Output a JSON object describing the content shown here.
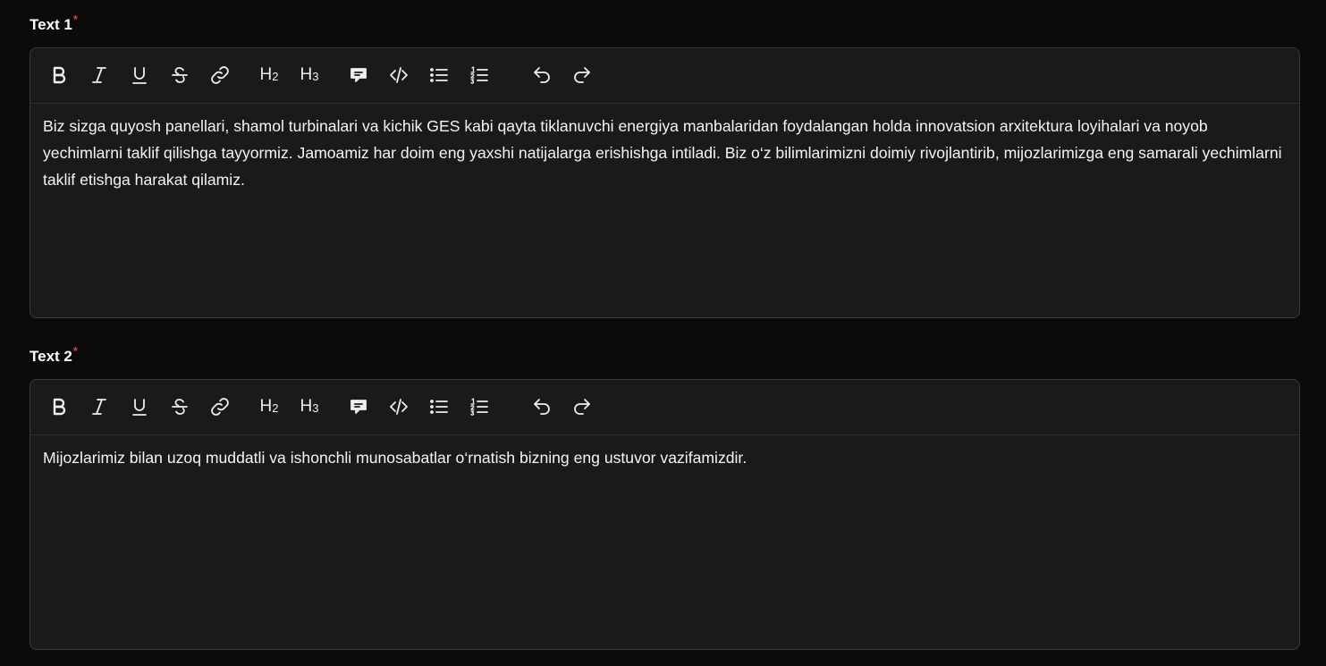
{
  "fields": [
    {
      "label": "Text 1",
      "required_mark": "*",
      "content": "Biz sizga quyosh panellari, shamol turbinalari va kichik GES kabi qayta tiklanuvchi energiya manbalaridan foydalangan holda innovatsion arxitektura loyihalari va noyob yechimlarni taklif qilishga tayyormiz. Jamoamiz har doim eng yaxshi natijalarga erishishga intiladi. Biz o‘z bilimlarimizni doimiy rivojlantirib, mijozlarimizga eng samarali yechimlarni taklif etishga harakat qilamiz."
    },
    {
      "label": "Text 2",
      "required_mark": "*",
      "content": "Mijozlarimiz bilan uzoq muddatli va ishonchli munosabatlar o‘rnatish bizning eng ustuvor vazifamizdir."
    }
  ],
  "toolbar": {
    "h2_label": "H",
    "h2_sub": "2",
    "h3_label": "H",
    "h3_sub": "3",
    "icons": [
      "bold-icon",
      "italic-icon",
      "underline-icon",
      "strikethrough-icon",
      "link-icon",
      "heading-2-icon",
      "heading-3-icon",
      "comment-icon",
      "code-icon",
      "bullet-list-icon",
      "ordered-list-icon",
      "undo-icon",
      "redo-icon"
    ]
  },
  "colors": {
    "background": "#0b0b0c",
    "editor_bg": "#1a1a1b",
    "border": "#3a3a3c",
    "required": "#e23b3b"
  }
}
